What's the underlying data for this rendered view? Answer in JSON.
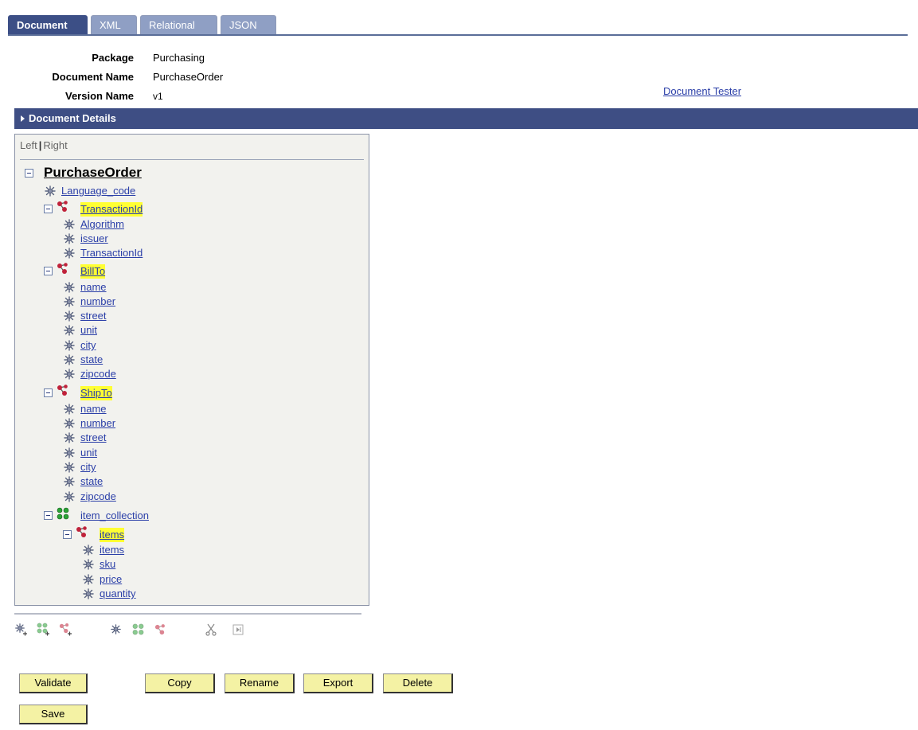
{
  "tabs": [
    {
      "label": "Document",
      "active": true
    },
    {
      "label": "XML",
      "active": false
    },
    {
      "label": "Relational",
      "active": false
    },
    {
      "label": "JSON",
      "active": false
    }
  ],
  "info": {
    "package_label": "Package",
    "package_value": "Purchasing",
    "docname_label": "Document Name",
    "docname_value": "PurchaseOrder",
    "version_label": "Version Name",
    "version_value": "v1",
    "tester_link": "Document Tester"
  },
  "details_bar": {
    "label": "Document Details"
  },
  "tree": {
    "left_label": "Left",
    "separator": "|",
    "right_label": "Right",
    "root": "PurchaseOrder",
    "n1": "Language_code",
    "n2": "TransactionId",
    "n3": "Algorithm",
    "n4": "issuer",
    "n5": "TransactionId",
    "n6": "BillTo",
    "n7": "name",
    "n8": "number",
    "n9": "street",
    "n10": "unit",
    "n11": "city",
    "n12": "state",
    "n13": "zipcode",
    "n14": "ShipTo",
    "n15": "name",
    "n16": "number",
    "n17": "street",
    "n18": "unit",
    "n19": "city",
    "n20": "state",
    "n21": "zipcode",
    "n22": "item_collection",
    "n23": "items",
    "n24": "items",
    "n25": "sku",
    "n26": "price",
    "n27": "quantity"
  },
  "buttons": {
    "validate": "Validate",
    "copy": "Copy",
    "rename": "Rename",
    "export": "Export",
    "delete": "Delete",
    "save": "Save"
  },
  "colors": {
    "tab_active": "#3c4f86",
    "tab_inactive": "#8f9fc4",
    "details_bar": "#3e4e84",
    "link": "#2b3fa8",
    "highlight": "#ffff33",
    "button": "#f4f2a4"
  }
}
